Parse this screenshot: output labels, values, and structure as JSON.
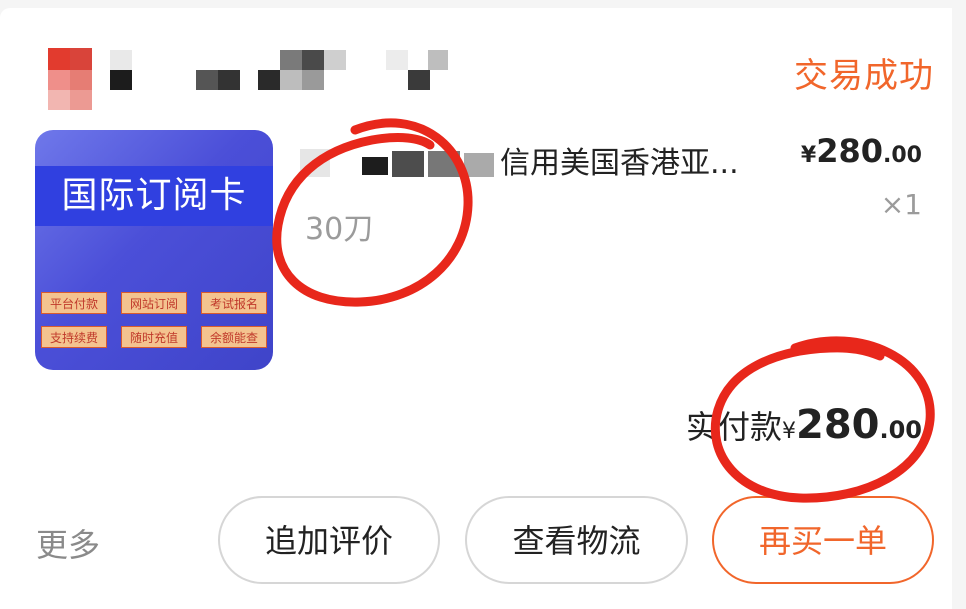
{
  "order": {
    "status": "交易成功"
  },
  "product": {
    "thumbnail": {
      "title": "国际订阅卡",
      "tags": [
        "平台付款",
        "网站订阅",
        "考试报名",
        "支持续费",
        "随时充值",
        "余额能查"
      ]
    },
    "title_visible": "信用美国香港亚...",
    "spec": "30刀",
    "price": {
      "currency": "¥",
      "integer": "280",
      "decimal": ".00"
    },
    "quantity": "×1"
  },
  "payment": {
    "label": "实付款",
    "currency": "¥",
    "integer": "280",
    "decimal": ".00"
  },
  "actions": {
    "more": "更多",
    "review": "追加评价",
    "logistics": "查看物流",
    "rebuy": "再买一单"
  },
  "colors": {
    "accent": "#f1662b",
    "annotation": "#e8271b"
  }
}
